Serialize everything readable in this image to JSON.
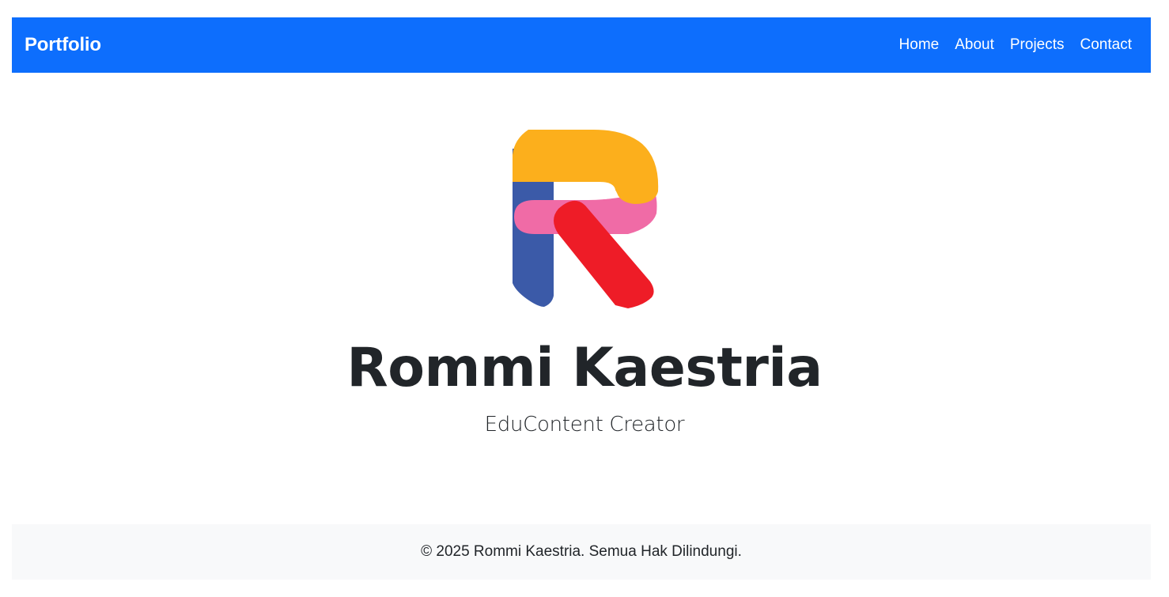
{
  "navbar": {
    "brand": "Portfolio",
    "links": [
      "Home",
      "About",
      "Projects",
      "Contact"
    ],
    "background": "#0d6efd"
  },
  "hero": {
    "logo_icon": "letter-r-logo-icon",
    "logo_colors": {
      "stem": "#3b5aa8",
      "top_arc": "#fcaf1c",
      "middle": "#f06ba6",
      "leg": "#ee1c27"
    },
    "name": "Rommi Kaestria",
    "tagline": "EduContent Creator"
  },
  "footer": {
    "text": "© 2025 Rommi Kaestria. Semua Hak Dilindungi."
  }
}
